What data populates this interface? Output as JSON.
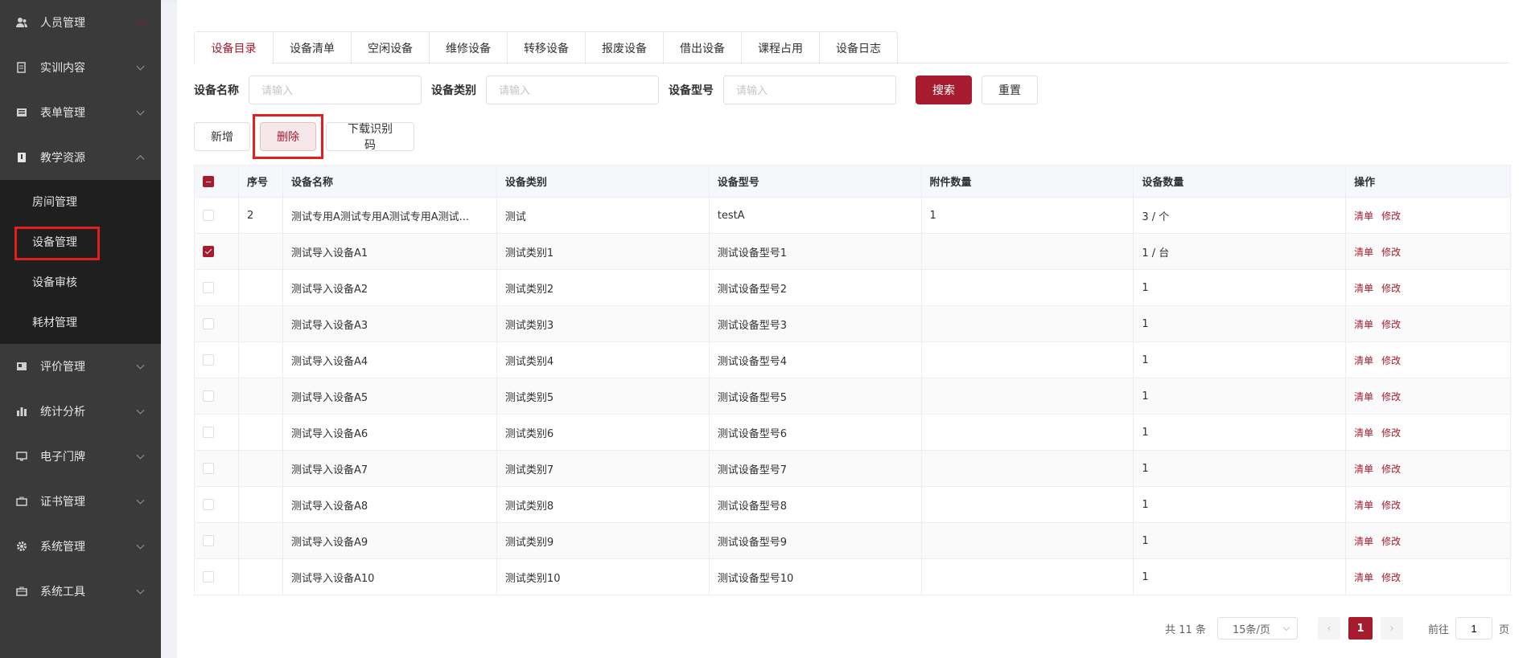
{
  "sidebar": {
    "items": [
      {
        "label": "人员管理",
        "icon": "users-icon"
      },
      {
        "label": "实训内容",
        "icon": "book-icon"
      },
      {
        "label": "表单管理",
        "icon": "form-icon"
      },
      {
        "label": "教学资源",
        "icon": "resource-icon"
      },
      {
        "label": "评价管理",
        "icon": "evaluate-icon"
      },
      {
        "label": "统计分析",
        "icon": "chart-icon"
      },
      {
        "label": "电子门牌",
        "icon": "monitor-icon"
      },
      {
        "label": "证书管理",
        "icon": "certificate-icon"
      },
      {
        "label": "系统管理",
        "icon": "gear-icon"
      },
      {
        "label": "系统工具",
        "icon": "toolbox-icon"
      }
    ],
    "submenu": [
      "房间管理",
      "设备管理",
      "设备审核",
      "耗材管理"
    ]
  },
  "tabs": [
    "设备目录",
    "设备清单",
    "空闲设备",
    "维修设备",
    "转移设备",
    "报废设备",
    "借出设备",
    "课程占用",
    "设备日志"
  ],
  "search": {
    "name_label": "设备名称",
    "type_label": "设备类别",
    "model_label": "设备型号",
    "placeholder": "请输入",
    "search_btn": "搜索",
    "reset_btn": "重置"
  },
  "actions": {
    "add": "新增",
    "delete": "删除",
    "download": "下载识别码"
  },
  "table": {
    "headers": [
      "序号",
      "设备名称",
      "设备类别",
      "设备型号",
      "附件数量",
      "设备数量",
      "操作"
    ],
    "rows": [
      {
        "no": "2",
        "name": "测试专用A测试专用A测试专用A测试...",
        "type": "测试",
        "model": "testA",
        "attach": "1",
        "qty": "3 / 个"
      },
      {
        "no": "",
        "name": "测试导入设备A1",
        "type": "测试类别1",
        "model": "测试设备型号1",
        "attach": "",
        "qty": "1 / 台"
      },
      {
        "no": "",
        "name": "测试导入设备A2",
        "type": "测试类别2",
        "model": "测试设备型号2",
        "attach": "",
        "qty": "1"
      },
      {
        "no": "",
        "name": "测试导入设备A3",
        "type": "测试类别3",
        "model": "测试设备型号3",
        "attach": "",
        "qty": "1"
      },
      {
        "no": "",
        "name": "测试导入设备A4",
        "type": "测试类别4",
        "model": "测试设备型号4",
        "attach": "",
        "qty": "1"
      },
      {
        "no": "",
        "name": "测试导入设备A5",
        "type": "测试类别5",
        "model": "测试设备型号5",
        "attach": "",
        "qty": "1"
      },
      {
        "no": "",
        "name": "测试导入设备A6",
        "type": "测试类别6",
        "model": "测试设备型号6",
        "attach": "",
        "qty": "1"
      },
      {
        "no": "",
        "name": "测试导入设备A7",
        "type": "测试类别7",
        "model": "测试设备型号7",
        "attach": "",
        "qty": "1"
      },
      {
        "no": "",
        "name": "测试导入设备A8",
        "type": "测试类别8",
        "model": "测试设备型号8",
        "attach": "",
        "qty": "1"
      },
      {
        "no": "",
        "name": "测试导入设备A9",
        "type": "测试类别9",
        "model": "测试设备型号9",
        "attach": "",
        "qty": "1"
      },
      {
        "no": "",
        "name": "测试导入设备A10",
        "type": "测试类别10",
        "model": "测试设备型号10",
        "attach": "",
        "qty": "1"
      }
    ],
    "op_list": "清单",
    "op_edit": "修改"
  },
  "pager": {
    "total": "共 11 条",
    "size": "15条/页",
    "current": "1",
    "goto": "前往",
    "goto_value": "1",
    "page_suffix": "页"
  },
  "colors": {
    "accent": "#a61b2d",
    "sidebar_bg": "#3a3a3a",
    "submenu_bg": "#1f1f1f",
    "highlight": "#e0201c"
  }
}
